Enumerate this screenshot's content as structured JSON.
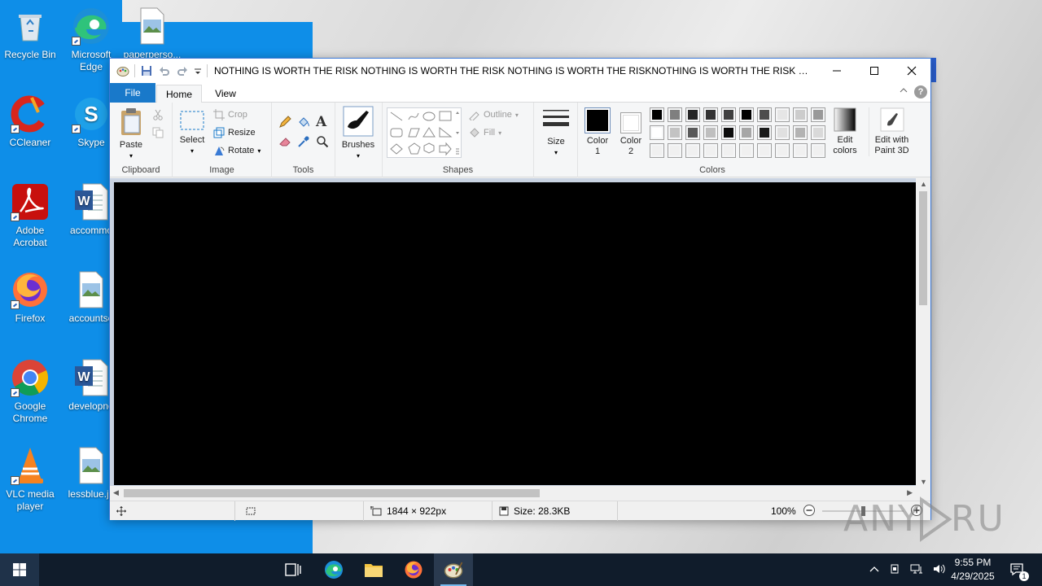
{
  "desktop": {
    "icons": [
      {
        "label": "Recycle Bin"
      },
      {
        "label": "Microsoft Edge"
      },
      {
        "label": "paperperso..."
      },
      {
        "label": "CCleaner"
      },
      {
        "label": "Skype"
      },
      {
        "label": "Adobe Acrobat"
      },
      {
        "label": "accommo"
      },
      {
        "label": "Firefox"
      },
      {
        "label": "accountse"
      },
      {
        "label": "Google Chrome"
      },
      {
        "label": "developno"
      },
      {
        "label": "VLC media player"
      },
      {
        "label": "lessblue.jp"
      }
    ]
  },
  "window": {
    "title": "NOTHING IS WORTH THE RISK NOTHING IS WORTH THE RISK NOTHING IS WORTH THE RISKNOTHING IS WORTH THE RISK NOTHING IS W...",
    "controls": {
      "minimize": "—",
      "maximize": "☐",
      "close": "✕"
    }
  },
  "tabs": {
    "file": "File",
    "home": "Home",
    "view": "View"
  },
  "ribbon": {
    "clipboard": {
      "paste": "Paste",
      "label": "Clipboard"
    },
    "image": {
      "select": "Select",
      "crop": "Crop",
      "resize": "Resize",
      "rotate": "Rotate",
      "label": "Image"
    },
    "tools": {
      "label": "Tools"
    },
    "brushes": {
      "label": "Brushes"
    },
    "shapes": {
      "outline": "Outline",
      "fill": "Fill",
      "label": "Shapes"
    },
    "size": {
      "label": "Size"
    },
    "colors": {
      "color1": "Color 1",
      "color2": "Color 2",
      "edit_colors": "Edit colors",
      "edit_paint3d": "Edit with Paint 3D",
      "label": "Colors",
      "color1_value": "#000000",
      "color2_value": "#ffffff",
      "palette": [
        [
          "#000000",
          "#7f7f7f",
          "#262626",
          "#333333",
          "#404040",
          "#000000",
          "#4d4d4d",
          "#e6e6e6",
          "#cccccc",
          "#999999"
        ],
        [
          "#ffffff",
          "#c3c3c3",
          "#595959",
          "#bfbfbf",
          "#0d0d0d",
          "#a6a6a6",
          "#1a1a1a",
          "#e0e0e0",
          "#b3b3b3",
          "#d9d9d9"
        ],
        [
          "#f0f0f0",
          "#f0f0f0",
          "#f0f0f0",
          "#f0f0f0",
          "#f0f0f0",
          "#f0f0f0",
          "#f0f0f0",
          "#f0f0f0",
          "#f0f0f0",
          "#f0f0f0"
        ]
      ]
    }
  },
  "statusbar": {
    "dimensions": "1844 × 922px",
    "size": "Size: 28.3KB",
    "zoom": "100%"
  },
  "taskbar": {
    "time": "9:55 PM",
    "date": "4/29/2025",
    "notification_count": "1"
  },
  "watermark": "ANY RUN"
}
